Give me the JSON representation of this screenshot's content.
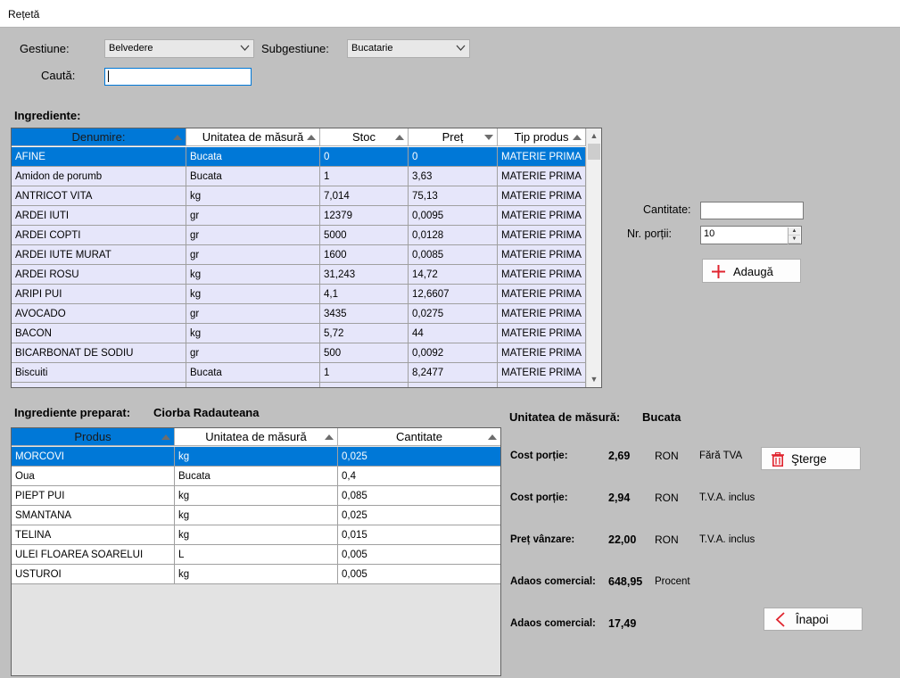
{
  "window": {
    "title": "Rețetă"
  },
  "filters": {
    "gestiune_label": "Gestiune:",
    "gestiune_value": "Belvedere",
    "subgestiune_label": "Subgestiune:",
    "subgestiune_value": "Bucatarie",
    "cauta_label": "Caută:",
    "cauta_value": ""
  },
  "ingrediente": {
    "title": "Ingrediente:",
    "columns": [
      "Denumire:",
      "Unitatea de măsură",
      "Stoc",
      "Preț",
      "Tip produs"
    ],
    "rows": [
      [
        "AFINE",
        "Bucata",
        "0",
        "0",
        "MATERIE PRIMA"
      ],
      [
        "Amidon de porumb",
        "Bucata",
        "1",
        "3,63",
        "MATERIE PRIMA"
      ],
      [
        "ANTRICOT VITA",
        "kg",
        "7,014",
        "75,13",
        "MATERIE PRIMA"
      ],
      [
        "ARDEI  IUTI",
        "gr",
        "12379",
        "0,0095",
        "MATERIE PRIMA"
      ],
      [
        "ARDEI COPTI",
        "gr",
        "5000",
        "0,0128",
        "MATERIE PRIMA"
      ],
      [
        "ARDEI IUTE MURAT",
        "gr",
        "1600",
        "0,0085",
        "MATERIE PRIMA"
      ],
      [
        "ARDEI ROSU",
        "kg",
        "31,243",
        "14,72",
        "MATERIE PRIMA"
      ],
      [
        "ARIPI PUI",
        "kg",
        "4,1",
        "12,6607",
        "MATERIE PRIMA"
      ],
      [
        "AVOCADO",
        "gr",
        "3435",
        "0,0275",
        "MATERIE PRIMA"
      ],
      [
        "BACON",
        "kg",
        "5,72",
        "44",
        "MATERIE PRIMA"
      ],
      [
        "BICARBONAT DE SODIU",
        "gr",
        "500",
        "0,0092",
        "MATERIE PRIMA"
      ],
      [
        "Biscuiti",
        "Bucata",
        "1",
        "8,2477",
        "MATERIE PRIMA"
      ]
    ]
  },
  "add_panel": {
    "cantitate_label": "Cantitate:",
    "cantitate_value": "",
    "portii_label": "Nr. porții:",
    "portii_value": "10",
    "add_button": "Adaugă"
  },
  "preparat": {
    "title": "Ingrediente preparat:",
    "name": "Ciorba Radauteana",
    "columns": [
      "Produs",
      "Unitatea de măsură",
      "Cantitate"
    ],
    "rows": [
      [
        "MORCOVI",
        "kg",
        "0,025"
      ],
      [
        "Oua",
        "Bucata",
        "0,4"
      ],
      [
        "PIEPT PUI",
        "kg",
        "0,085"
      ],
      [
        "SMANTANA",
        "kg",
        "0,025"
      ],
      [
        "TELINA",
        "kg",
        "0,015"
      ],
      [
        "ULEI FLOAREA SOARELUI",
        "L",
        "0,005"
      ],
      [
        "USTUROI",
        "kg",
        "0,005"
      ]
    ]
  },
  "summary": {
    "um_label": "Unitatea de măsură:",
    "um_value": "Bucata",
    "cost1_label": "Cost porție:",
    "cost1_value": "2,69",
    "cost1_unit": "RON",
    "cost1_note": "Fără TVA",
    "cost2_label": "Cost porție:",
    "cost2_value": "2,94",
    "cost2_unit": "RON",
    "cost2_note": "T.V.A. inclus",
    "pret_label": "Preț vânzare:",
    "pret_value": "22,00",
    "pret_unit": "RON",
    "pret_note": "T.V.A. inclus",
    "adaos1_label": "Adaos comercial:",
    "adaos1_value": "648,95",
    "adaos1_unit": "Procent",
    "adaos2_label": "Adaos comercial:",
    "adaos2_value": "17,49",
    "sterge_button": "Şterge",
    "inapoi_button": "Înapoi"
  },
  "colors": {
    "selection": "#0078d7",
    "alt_row": "#e6e6fa",
    "background": "#c0c0c0",
    "accent_icon": "#e0242e"
  }
}
